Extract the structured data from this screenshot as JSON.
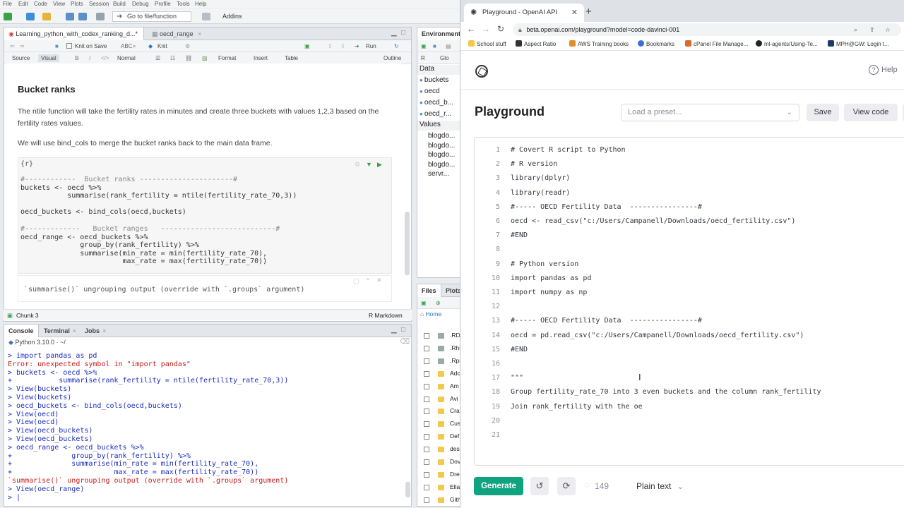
{
  "rstudio": {
    "menu": [
      "File",
      "Edit",
      "Code",
      "View",
      "Plots",
      "Session",
      "Build",
      "Debug",
      "Profile",
      "Tools",
      "Help"
    ],
    "goto_file_placeholder": "Go to file/function",
    "addins_label": "Addins",
    "source_tabs": [
      {
        "label": "Learning_python_with_codex_ranking_d...*"
      },
      {
        "label": "oecd_range"
      }
    ],
    "editor_toolbar": {
      "knit_on_save": "Knit on Save",
      "knit": "Knit",
      "run": "Run"
    },
    "format_bar": {
      "source": "Source",
      "visual": "Visual",
      "bold": "B",
      "italic": "I",
      "code": "</>",
      "normal": "Normal",
      "format": "Format",
      "insert": "Insert",
      "table": "Table",
      "outline": "Outline"
    },
    "doc": {
      "heading": "Bucket ranks",
      "para1": "The ntile function will take the fertility rates in minutes and create three buckets with values 1,2,3 based on the fertility rates values.",
      "para2": "We will use bind_cols to merge the bucket ranks back to the main data frame.",
      "chunk_header": "{r}",
      "code_lines": [
        "#------------  Bucket ranks ----------------------#",
        "buckets <- oecd %>%",
        "           summarise(rank_fertility = ntile(fertility_rate_70,3))",
        "",
        "oecd_buckets <- bind_cols(oecd,buckets)",
        "",
        "#-------------   Bucket ranges   ---------------------------#",
        "oecd_range <- oecd_buckets %>%",
        "              group_by(rank_fertility) %>%",
        "              summarise(min_rate = min(fertility_rate_70),",
        "                        max_rate = max(fertility_rate_70))"
      ],
      "chunk_output": "`summarise()` ungrouping output (override with `.groups` argument)"
    },
    "status_left": "Chunk 3",
    "status_right": "R Markdown",
    "console_tabs": [
      "Console",
      "Terminal",
      "Jobs"
    ],
    "console_header": "Python 3.10.0  ·  ~/",
    "console_lines": [
      {
        "text": "> import pandas as pd",
        "kind": "cmd"
      },
      {
        "text": "Error: unexpected symbol in \"import pandas\"",
        "kind": "err"
      },
      {
        "text": "> buckets <- oecd %>%",
        "kind": "cmd"
      },
      {
        "text": "+           summarise(rank_fertility = ntile(fertility_rate_70,3))",
        "kind": "cmd"
      },
      {
        "text": "> View(buckets)",
        "kind": "cmd"
      },
      {
        "text": "> View(buckets)",
        "kind": "cmd"
      },
      {
        "text": "> oecd_buckets <- bind_cols(oecd,buckets)",
        "kind": "cmd"
      },
      {
        "text": "> View(oecd)",
        "kind": "cmd"
      },
      {
        "text": "> View(oecd)",
        "kind": "cmd"
      },
      {
        "text": "> View(oecd_buckets)",
        "kind": "cmd"
      },
      {
        "text": "> View(oecd_buckets)",
        "kind": "cmd"
      },
      {
        "text": "> oecd_range <- oecd_buckets %>%",
        "kind": "cmd"
      },
      {
        "text": "+              group_by(rank_fertility) %>%",
        "kind": "cmd"
      },
      {
        "text": "+              summarise(min_rate = min(fertility_rate_70),",
        "kind": "cmd"
      },
      {
        "text": "+                        max_rate = max(fertility_rate_70))",
        "kind": "cmd"
      },
      {
        "text": "`summarise()` ungrouping output (override with `.groups` argument)",
        "kind": "err"
      },
      {
        "text": "> View(oecd_range)",
        "kind": "cmd"
      },
      {
        "text": "> |",
        "kind": "cmd"
      }
    ],
    "env": {
      "tab": "Environment",
      "r_label": "R",
      "glo_label": "Glo",
      "data_heading": "Data",
      "data_items": [
        "buckets",
        "oecd",
        "oecd_b...",
        "oecd_r..."
      ],
      "values_heading": "Values",
      "values_items": [
        "blogdo...",
        "blogdo...",
        "blogdo...",
        "blogdo...",
        "servr..."
      ]
    },
    "files": {
      "tabs": [
        "Files",
        "Plots"
      ],
      "home": "Home",
      "items": [
        ".RD",
        ".Rhi",
        ".Rpr",
        "Adc",
        "Am",
        "Avi",
        "Cra",
        "Cus",
        "Def",
        "desi",
        "Dov",
        "Dre",
        "Ella",
        "Gith"
      ]
    }
  },
  "browser": {
    "tab_title": "Playground - OpenAI API",
    "url": "beta.openai.com/playground?model=code-davinci-001",
    "bookmarks": [
      "School stuff",
      "Aspect Ratio",
      "AWS Training books",
      "Bookmarks",
      "cPanel File Manage...",
      "ml-agents/Using-Te...",
      "MPH@GW: Login t..."
    ],
    "help": "Help",
    "title": "Playground",
    "preset_placeholder": "Load a preset...",
    "save": "Save",
    "view_code": "View code",
    "lines": [
      "# Covert R script to Python",
      "# R version",
      "library(dplyr)",
      "library(readr)",
      "#----- OECD Fertility Data  ----------------#",
      "oecd <- read_csv(\"c:/Users/Campanell/Downloads/oecd_fertility.csv\")",
      "#END",
      "",
      "# Python version",
      "import pandas as pd",
      "import numpy as np",
      "",
      "#----- OECD Fertility Data  ----------------#",
      "oecd = pd.read_csv(\"c:/Users/Campanell/Downloads/oecd_fertility.csv\")",
      "#END",
      "",
      "\"\"\"",
      "Group fertility_rate_70 into 3 even buckets and the column rank_fertility",
      "Join rank_fertility with the oe",
      "",
      ""
    ],
    "generate": "Generate",
    "tokens": "149",
    "mode": "Plain text"
  }
}
